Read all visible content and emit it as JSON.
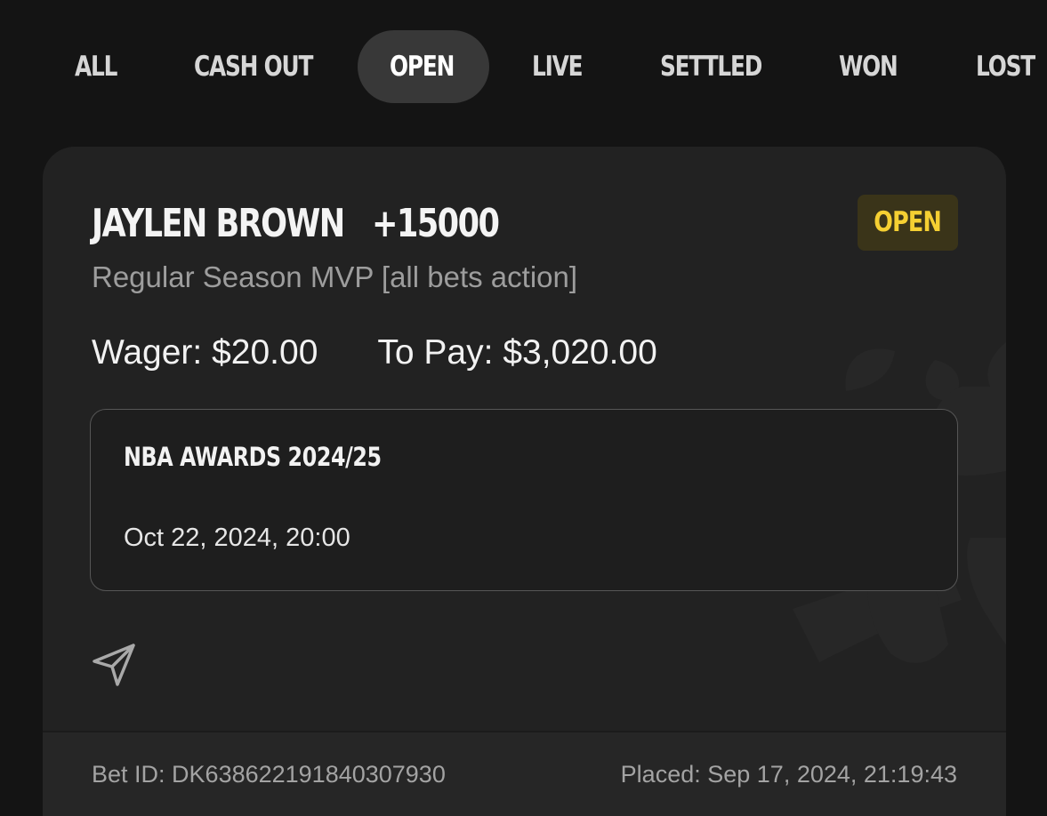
{
  "tabs": [
    {
      "label": "ALL",
      "active": false
    },
    {
      "label": "CASH OUT",
      "active": false
    },
    {
      "label": "OPEN",
      "active": true
    },
    {
      "label": "LIVE",
      "active": false
    },
    {
      "label": "SETTLED",
      "active": false
    },
    {
      "label": "WON",
      "active": false
    },
    {
      "label": "LOST",
      "active": false
    }
  ],
  "bet": {
    "selection": "JAYLEN BROWN",
    "odds": "+15000",
    "status": "OPEN",
    "market": "Regular Season MVP [all bets action]",
    "wager_label": "Wager:",
    "wager_value": "$20.00",
    "to_pay_label": "To Pay:",
    "to_pay_value": "$3,020.00",
    "event": {
      "name": "NBA AWARDS 2024/25",
      "date": "Oct 22, 2024, 20:00"
    },
    "footer": {
      "bet_id_label": "Bet ID:",
      "bet_id": "DK638622191840307930",
      "placed_label": "Placed:",
      "placed": "Sep 17, 2024, 21:19:43"
    }
  },
  "icons": {
    "share": "send-icon",
    "watermark": "crown-logo-watermark"
  },
  "colors": {
    "background": "#141414",
    "card": "#222222",
    "active_tab_pill": "#383838",
    "status_badge_bg": "#3a3419",
    "status_badge_text": "#f5cf32",
    "muted_text": "#9d9d9d"
  }
}
